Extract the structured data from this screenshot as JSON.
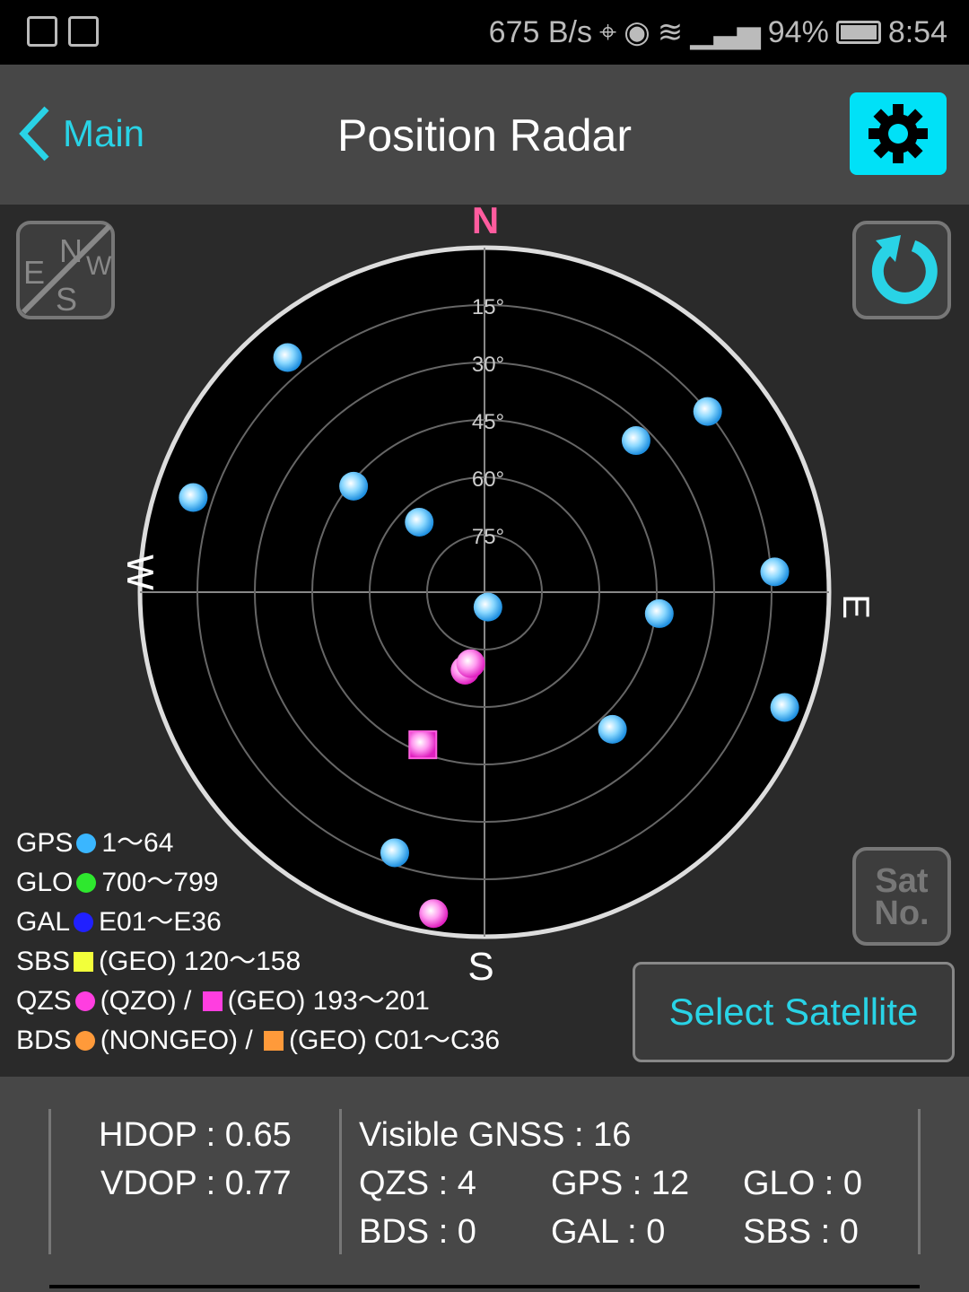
{
  "status_bar": {
    "speed": "675 B/s",
    "battery": "94%",
    "time": "8:54",
    "icons": [
      "mute-icon",
      "mail-icon",
      "location-icon",
      "eye-icon",
      "wifi-icon",
      "signal-icon",
      "battery-icon"
    ]
  },
  "header": {
    "back_label": "Main",
    "title": "Position Radar",
    "settings_icon": "gear-icon"
  },
  "colors": {
    "accent": "#29d3e6",
    "gear_bg": "#00e1f7",
    "north": "#ff5c9e",
    "gps": "#3ab6ff",
    "glo": "#2ee82e",
    "gal": "#2020ff",
    "sbs": "#f2ff3a",
    "qzs": "#ff3ee0",
    "bds": "#ff9a3a"
  },
  "radar": {
    "directions": {
      "n": "N",
      "s": "S",
      "e": "E",
      "w": "W"
    },
    "ring_labels": [
      "15°",
      "30°",
      "45°",
      "60°",
      "75°"
    ],
    "compass_toggle_letters": [
      "N",
      "E",
      "S",
      "W"
    ],
    "refresh_icon": "refresh-icon",
    "sat_no_label": [
      "Sat",
      "No."
    ]
  },
  "chart_data": {
    "type": "scatter",
    "coordinates": "polar azimuth (deg from north, clockwise) / elevation (deg)",
    "elevation_rings": [
      15,
      30,
      45,
      60,
      75
    ],
    "satellites": [
      {
        "system": "GPS",
        "shape": "circle",
        "az": 320,
        "el": 10
      },
      {
        "system": "GPS",
        "shape": "circle",
        "az": 51,
        "el": 15
      },
      {
        "system": "GPS",
        "shape": "circle",
        "az": 45,
        "el": 34
      },
      {
        "system": "GPS",
        "shape": "circle",
        "az": 288,
        "el": 10
      },
      {
        "system": "GPS",
        "shape": "circle",
        "az": 309,
        "el": 46
      },
      {
        "system": "GPS",
        "shape": "circle",
        "az": 317,
        "el": 65
      },
      {
        "system": "GPS",
        "shape": "circle",
        "az": 86,
        "el": 14
      },
      {
        "system": "GPS",
        "shape": "circle",
        "az": 167,
        "el": 86
      },
      {
        "system": "GPS",
        "shape": "circle",
        "az": 97,
        "el": 44
      },
      {
        "system": "GPS",
        "shape": "circle",
        "az": 111,
        "el": 6
      },
      {
        "system": "GPS",
        "shape": "circle",
        "az": 137,
        "el": 41
      },
      {
        "system": "GPS",
        "shape": "circle",
        "az": 199,
        "el": 18
      },
      {
        "system": "QZS",
        "shape": "circle",
        "az": 194,
        "el": 69
      },
      {
        "system": "QZS",
        "shape": "circle",
        "az": 191,
        "el": 71
      },
      {
        "system": "QZS",
        "shape": "circle",
        "az": 189,
        "el": 5
      },
      {
        "system": "QZS",
        "shape": "square",
        "az": 202,
        "el": 47
      }
    ]
  },
  "legend": [
    {
      "name": "GPS",
      "key": "gps",
      "parts": [
        {
          "shape": "dot",
          "key": "gps",
          "text": "1〜64"
        }
      ]
    },
    {
      "name": "GLO",
      "key": "glo",
      "parts": [
        {
          "shape": "dot",
          "key": "glo",
          "text": "700〜799"
        }
      ]
    },
    {
      "name": "GAL",
      "key": "gal",
      "parts": [
        {
          "shape": "dot",
          "key": "gal",
          "text": "E01〜E36"
        }
      ]
    },
    {
      "name": "SBS",
      "key": "sbs",
      "parts": [
        {
          "shape": "sq",
          "key": "sbs",
          "text": "(GEO) 120〜158"
        }
      ]
    },
    {
      "name": "QZS",
      "key": "qzs",
      "parts": [
        {
          "shape": "dot",
          "key": "qzs",
          "text": "(QZO) /"
        },
        {
          "shape": "sq",
          "key": "qzs",
          "text": "(GEO) 193〜201"
        }
      ]
    },
    {
      "name": "BDS",
      "key": "bds",
      "parts": [
        {
          "shape": "dot",
          "key": "bds",
          "text": "(NONGEO) /"
        },
        {
          "shape": "sq",
          "key": "bds",
          "text": "(GEO) C01〜C36"
        }
      ]
    }
  ],
  "select_button": "Select Satellite",
  "footer": {
    "hdop": "HDOP : 0.65",
    "vdop": "VDOP : 0.77",
    "visible": "Visible GNSS : 16",
    "qzs": "QZS : 4",
    "gps": "GPS : 12",
    "glo": "GLO : 0",
    "bds": "BDS : 0",
    "gal": "GAL : 0",
    "sbs": "SBS : 0"
  }
}
